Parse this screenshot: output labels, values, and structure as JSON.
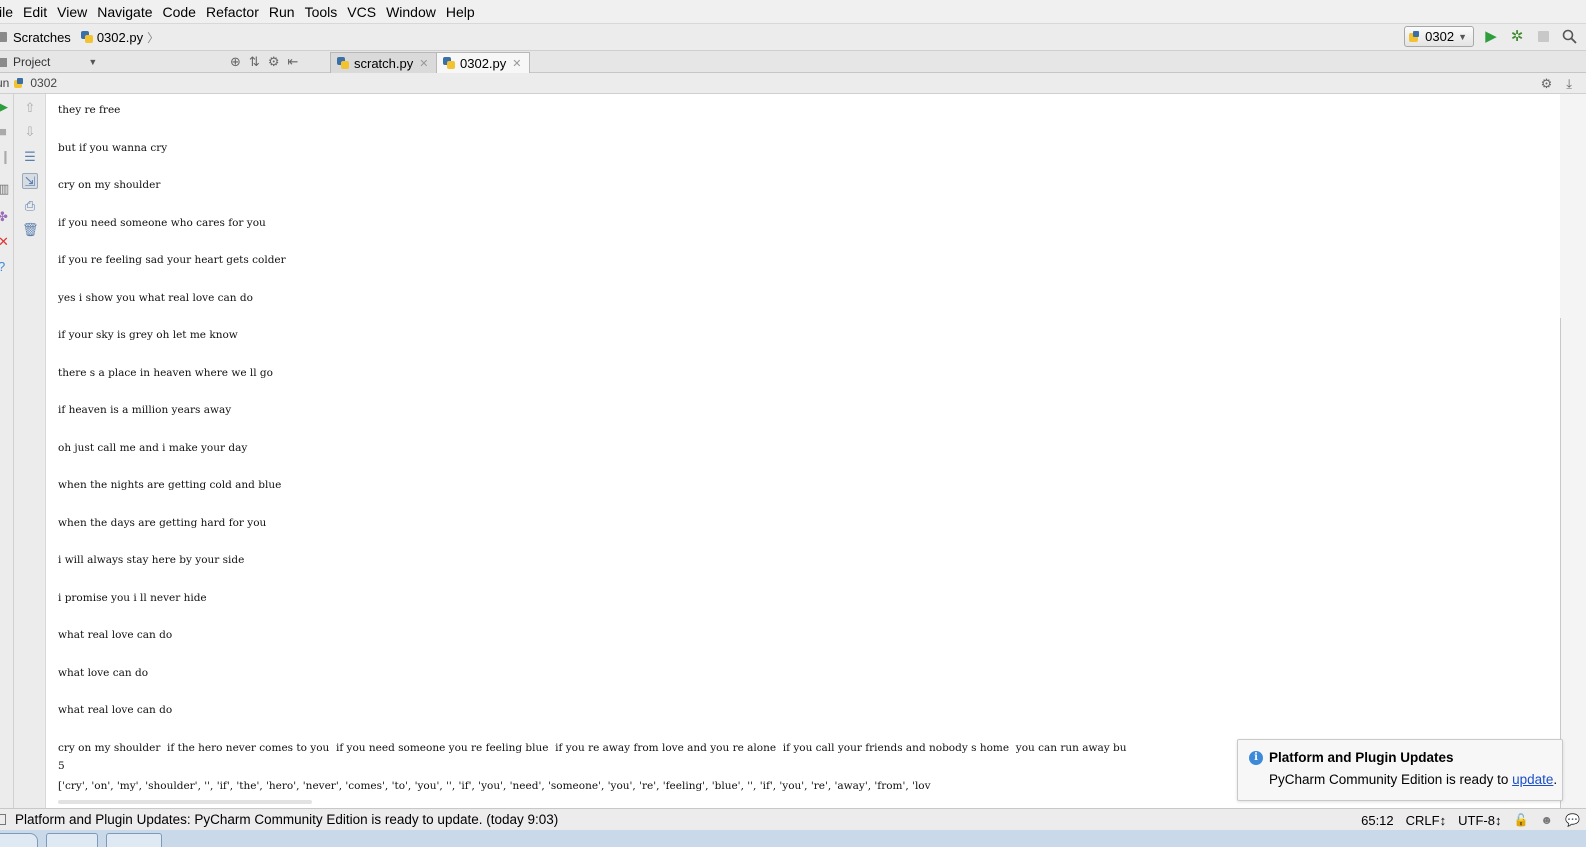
{
  "menu": [
    "ile",
    "Edit",
    "View",
    "Navigate",
    "Code",
    "Refactor",
    "Run",
    "Tools",
    "VCS",
    "Window",
    "Help"
  ],
  "breadcrumb": {
    "folder": "Scratches",
    "file": "0302.py"
  },
  "run_config": "0302",
  "project_panel": {
    "label": "Project"
  },
  "tabs": [
    {
      "label": "scratch.py",
      "active": false
    },
    {
      "label": "0302.py",
      "active": true
    }
  ],
  "run_header": {
    "label": "un",
    "config": "0302"
  },
  "console_lines": [
    "they re free",
    "but if you wanna cry",
    "cry on my shoulder",
    "if you need someone who cares for you",
    "if you re feeling sad your heart gets colder",
    "yes i show you what real love can do",
    "if your sky is grey oh let me know",
    "there s a place in heaven where we ll go",
    "if heaven is a million years away",
    "oh just call me and i make your day",
    "when the nights are getting cold and blue",
    "when the days are getting hard for you",
    "i will always stay here by your side",
    "i promise you i ll never hide",
    "what real love can do",
    "what love can do",
    "what real love can do",
    "cry on my shoulder  if the hero never comes to you  if you need someone you re feeling blue  if you re away from love and you re alone  if you call your friends and nobody s home  you can run away bu",
    "5",
    "['cry', 'on', 'my', 'shoulder', '', 'if', 'the', 'hero', 'never', 'comes', 'to', 'you', '', 'if', 'you', 'need', 'someone', 'you', 're', 'feeling', 'blue', '', 'if', 'you', 're', 'away', 'from', 'lov"
  ],
  "notification": {
    "title": "Platform and Plugin Updates",
    "body_prefix": "PyCharm Community Edition is ready to ",
    "link": "update",
    "body_suffix": "."
  },
  "status": {
    "message": "Platform and Plugin Updates: PyCharm Community Edition is ready to update. (today 9:03)",
    "position": "65:12",
    "line_sep": "CRLF↕",
    "encoding": "UTF-8↕"
  },
  "colors": {
    "run_green": "#2e9d3b",
    "info_blue": "#3d8ad9",
    "link_blue": "#1a4fc9"
  }
}
